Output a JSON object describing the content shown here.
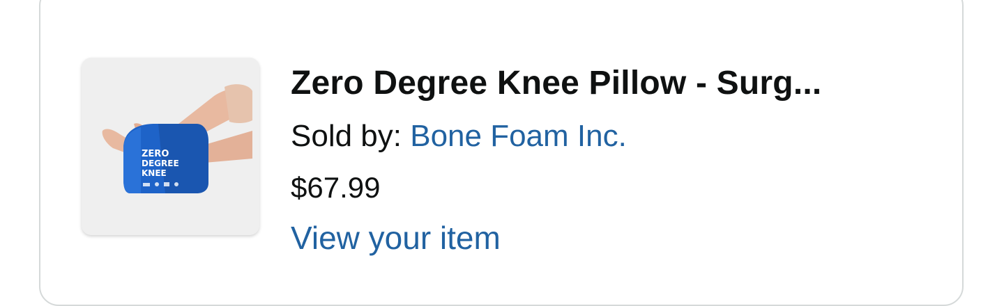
{
  "item": {
    "title": "Zero Degree Knee Pillow - Surg...",
    "sold_by_label": "Sold by: ",
    "seller_name": "Bone Foam Inc.",
    "price": "$67.99",
    "view_link": "View your item",
    "image": {
      "brand_text_top": "ZERO",
      "brand_text_mid": "DEGREE",
      "brand_text_bottom": "KNEE",
      "pillow_color": "#1e63c8"
    }
  },
  "colors": {
    "link": "#2162a1",
    "text": "#0f1111",
    "border": "#d5d9d9"
  }
}
